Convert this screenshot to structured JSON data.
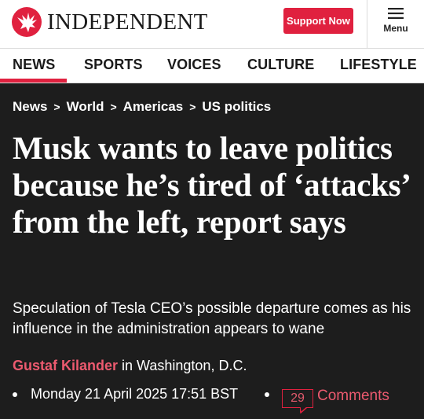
{
  "header": {
    "logo_text": "INDEPENDENT",
    "support_label": "Support Now",
    "menu_label": "Menu"
  },
  "nav": {
    "items": [
      "NEWS",
      "SPORTS",
      "VOICES",
      "CULTURE",
      "LIFESTYLE"
    ],
    "active": "NEWS"
  },
  "breadcrumb": {
    "items": [
      "News",
      "World",
      "Americas",
      "US politics"
    ],
    "separator": ">"
  },
  "article": {
    "headline": "Musk wants to leave politics because he’s tired of ‘attacks’ from the left, report says",
    "standfirst": "Speculation of Tesla CEO’s possible departure comes as his influence in the administration appears to wane",
    "author": "Gustaf Kilander",
    "location": "in Washington, D.C.",
    "date": "Monday 21 April 2025 17:51 BST",
    "comment_count": "29",
    "comments_label": "Comments"
  },
  "colors": {
    "brand_red": "#e0213f",
    "background": "#1d1d1d",
    "author_link": "#ec5a6f"
  },
  "icons": {
    "logo": "eagle-logo-icon",
    "menu": "hamburger-menu-icon",
    "comments": "speech-bubble-icon"
  }
}
